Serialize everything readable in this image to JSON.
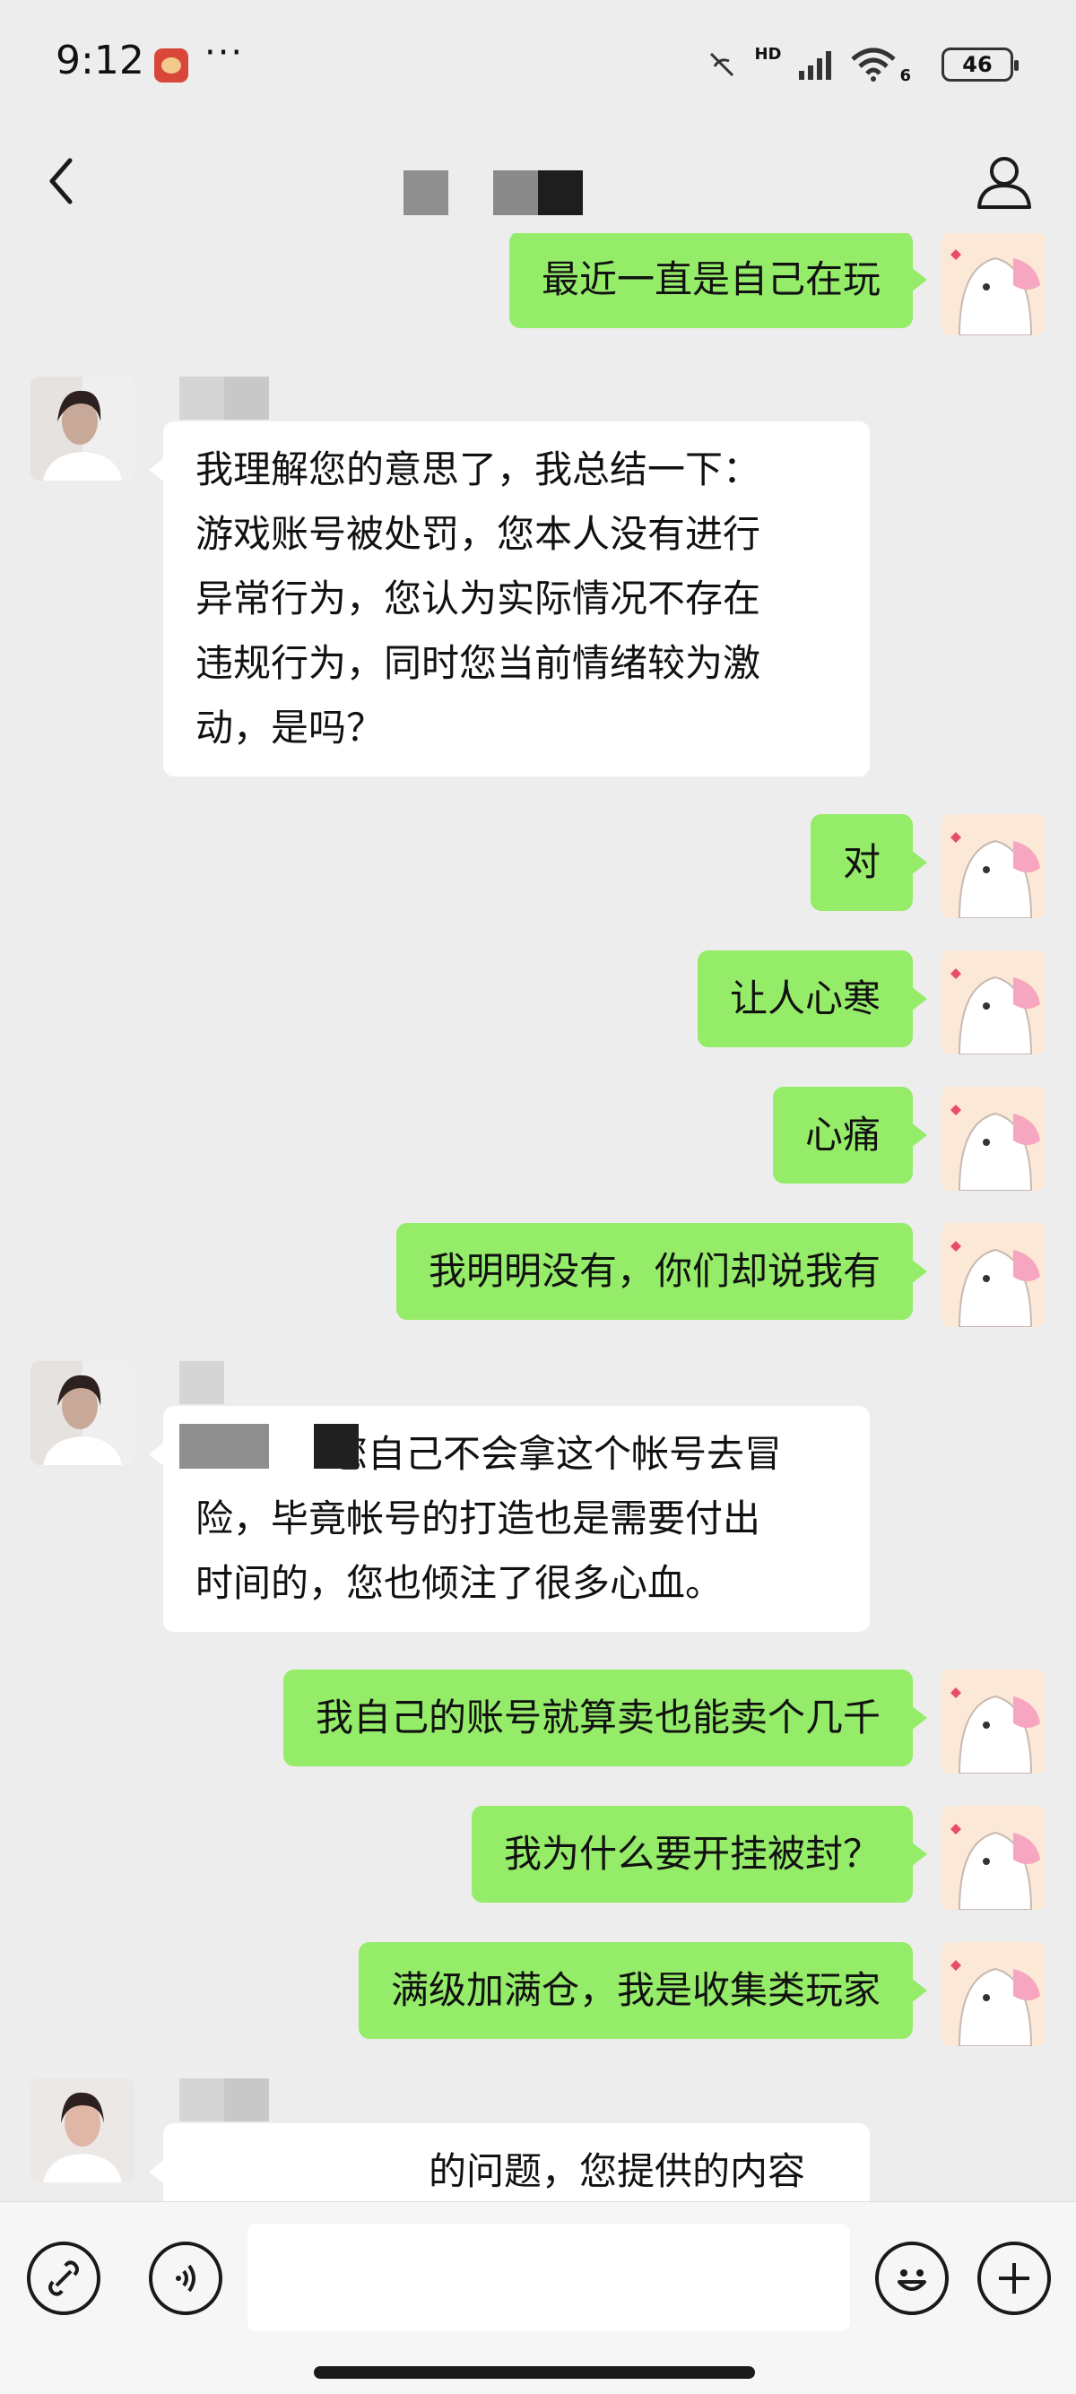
{
  "status_bar": {
    "time": "9:12",
    "more": "···",
    "network": "HD",
    "wifi_gen": "6",
    "battery": "46"
  },
  "nav": {
    "back_icon": "chevron-left-icon",
    "user_icon": "person-icon"
  },
  "messages": [
    {
      "side": "right",
      "text": "最近一直是自己在玩"
    },
    {
      "side": "left",
      "lines": [
        "我理解您的意思了，我总结一下：",
        "游戏账号被处罚，您本人没有进行",
        "异常行为，您认为实际情况不存在",
        "违规行为，同时您当前情绪较为激",
        "动，是吗？"
      ]
    },
    {
      "side": "right",
      "text": "对"
    },
    {
      "side": "right",
      "text": "让人心寒"
    },
    {
      "side": "right",
      "text": "心痛"
    },
    {
      "side": "right",
      "text": "我明明没有，你们却说我有"
    },
    {
      "side": "left",
      "lines": [
        "您自己不会拿这个帐号去冒",
        "险，毕竟帐号的打造也是需要付出",
        "时间的，您也倾注了很多心血。"
      ]
    },
    {
      "side": "right",
      "text": "我自己的账号就算卖也能卖个几千"
    },
    {
      "side": "right",
      "text": "我为什么要开挂被封？"
    },
    {
      "side": "right",
      "text": "满级加满仓，我是收集类玩家"
    },
    {
      "side": "left",
      "lines": [
        "的问题，您提供的内容"
      ]
    }
  ],
  "input_bar": {
    "voice_icon": "voice-icon",
    "emoji_icon": "emoji-icon",
    "plus_icon": "plus-icon",
    "link_icon": "link-icon"
  },
  "colors": {
    "background": "#ededed",
    "bubble_self": "#95ec69",
    "bubble_other": "#ffffff"
  }
}
